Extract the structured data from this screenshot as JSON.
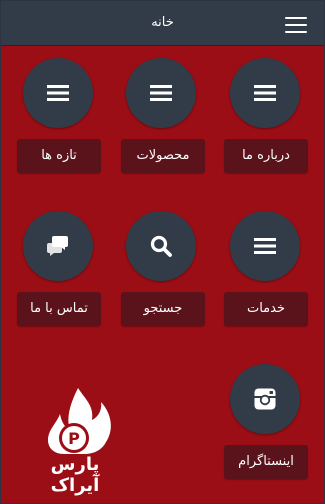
{
  "header": {
    "title": "خانه",
    "menu_icon": "hamburger-menu-icon"
  },
  "tiles": [
    {
      "label": "درباره ما",
      "icon": "menu-lines-icon"
    },
    {
      "label": "محصولات",
      "icon": "menu-lines-icon"
    },
    {
      "label": "تازه ها",
      "icon": "menu-lines-icon"
    },
    {
      "label": "خدمات",
      "icon": "menu-lines-icon"
    },
    {
      "label": "جستجو",
      "icon": "search-icon"
    },
    {
      "label": "تماس با ما",
      "icon": "chat-bubbles-icon"
    },
    {
      "label": "اینستاگرام",
      "icon": "instagram-icon"
    }
  ],
  "logo": {
    "text": "پارس آیراک",
    "icon": "flame-p-logo-icon"
  },
  "colors": {
    "background": "#9b0e16",
    "topbar": "#323c48",
    "circle": "#323c48",
    "label_button": "#5a121b",
    "text": "#ffffff"
  }
}
